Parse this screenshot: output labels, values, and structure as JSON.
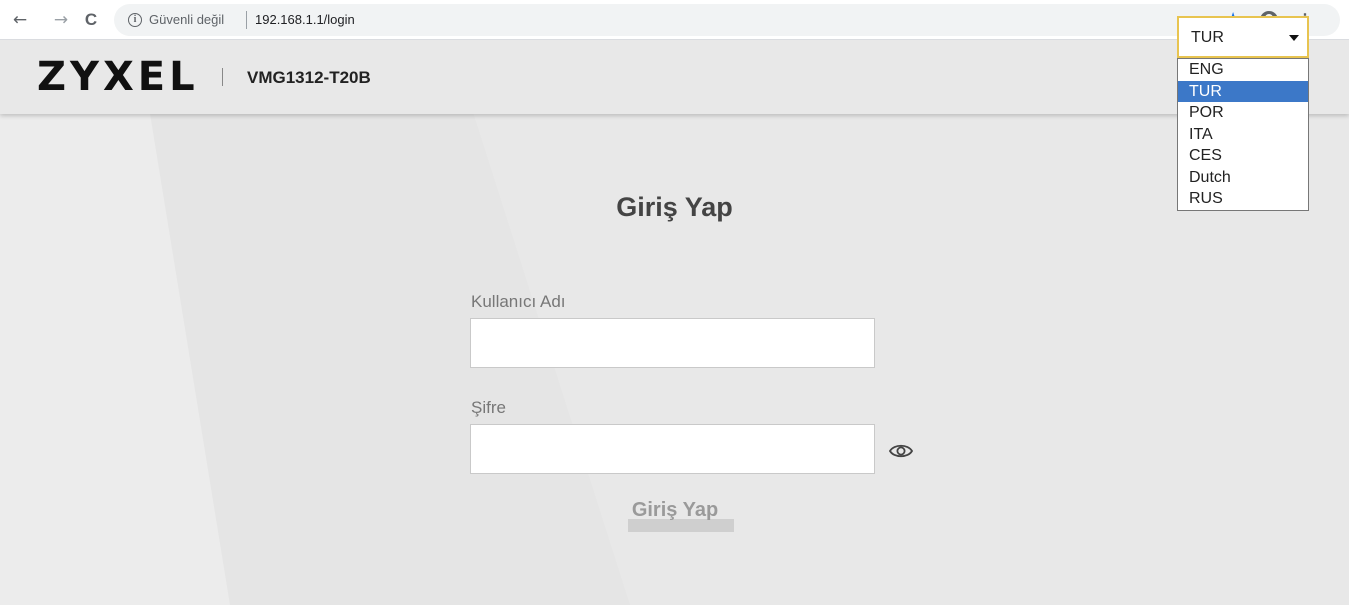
{
  "browser": {
    "back_icon": "←",
    "forward_icon": "→",
    "reload_icon": "C",
    "security_text": "Güvenli değil",
    "url": "192.168.1.1/login",
    "star_icon": "★",
    "menu_icon": "⋮"
  },
  "header": {
    "logo": "ZYXEL",
    "model": "VMG1312-T20B"
  },
  "language": {
    "selected": "TUR",
    "options": [
      "ENG",
      "TUR",
      "POR",
      "ITA",
      "CES",
      "Dutch",
      "RUS"
    ]
  },
  "login": {
    "title": "Giriş Yap",
    "username_label": "Kullanıcı Adı",
    "username_value": "",
    "password_label": "Şifre",
    "password_value": "",
    "submit_label": "Giriş Yap"
  },
  "colors": {
    "accent_border": "#e8c450",
    "selected_option": "#3c78c8",
    "star": "#1a73e8"
  }
}
